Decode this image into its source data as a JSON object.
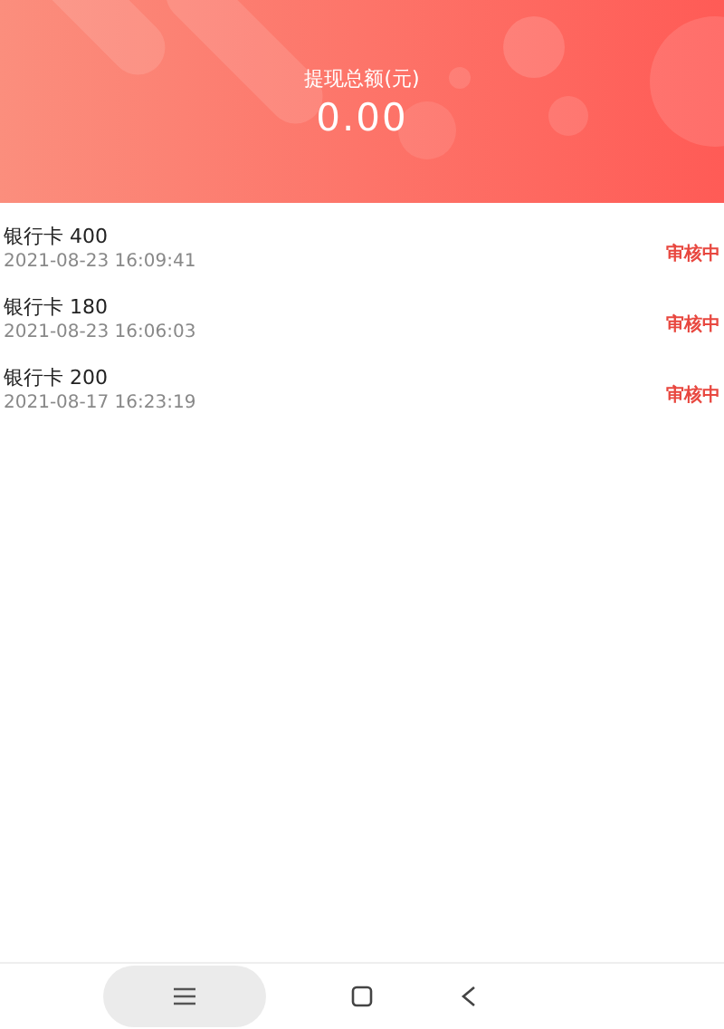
{
  "summary": {
    "label": "提现总额(元)",
    "amount": "0.00"
  },
  "records": [
    {
      "title": "银行卡 400",
      "time": "2021-08-23 16:09:41",
      "status": "审核中"
    },
    {
      "title": "银行卡 180",
      "time": "2021-08-23 16:06:03",
      "status": "审核中"
    },
    {
      "title": "银行卡 200",
      "time": "2021-08-17 16:23:19",
      "status": "审核中"
    }
  ]
}
